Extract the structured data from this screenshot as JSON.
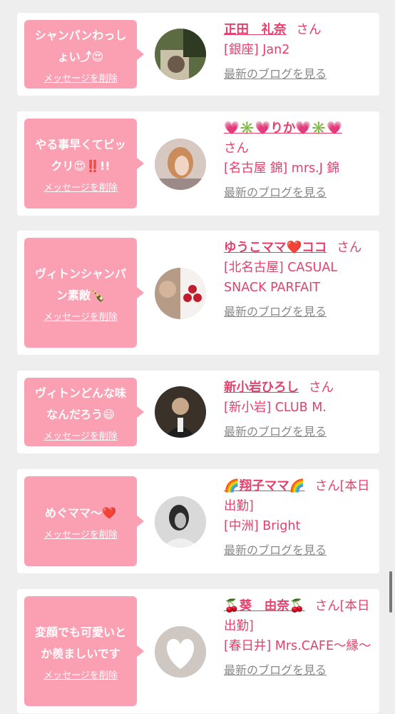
{
  "entries": [
    {
      "message_lines": [
        "シャンパンわっし",
        "ょい⤴😍"
      ],
      "delete_label": "メッセージを削除",
      "name": "正田　礼奈",
      "honorific": "さん",
      "shop": "[銀座] Jan2",
      "blog_label": "最新のブログを見る",
      "avatar": "photo-forest-window"
    },
    {
      "message_lines": [
        "やる事早くてビッ",
        "クリ😍‼️!!"
      ],
      "delete_label": "メッセージを削除",
      "name": "💗✳️💗りか💗✳️💗",
      "honorific": "さん",
      "shop": "[名古屋 錦] mrs.J 錦",
      "blog_label": "最新のブログを見る",
      "avatar": "photo-woman-blonde"
    },
    {
      "message_lines": [
        "ヴィトンシャンパ",
        "ン素敵🍾"
      ],
      "delete_label": "メッセージを削除",
      "name": "ゆうこママ❤️ココ",
      "honorific": "さん",
      "shop": "[北名古屋] CASUAL SNACK PARFAIT",
      "blog_label": "最新のブログを見る",
      "avatar": "photo-collage-cherries"
    },
    {
      "message_lines": [
        "ヴィトンどんな味",
        "なんだろう😄"
      ],
      "delete_label": "メッセージを削除",
      "name": "新小岩ひろし",
      "honorific": "さん",
      "shop": "[新小岩] CLUB M.",
      "blog_label": "最新のブログを見る",
      "avatar": "photo-man-suit"
    },
    {
      "message_lines": [
        "めぐママ〜❤️"
      ],
      "delete_label": "メッセージを削除",
      "name": "🌈翔子ママ🌈",
      "honorific": "さん[本日出勤]",
      "shop": "[中洲] Bright",
      "blog_label": "最新のブログを見る",
      "avatar": "photo-woman-bw"
    },
    {
      "message_lines": [
        "変顔でも可愛いと",
        "か羨ましいです"
      ],
      "delete_label": "メッセージを削除",
      "name": "🍒葵　由奈🍒",
      "honorific": "さん[本日出勤]",
      "shop": "[春日井] Mrs.CAFE〜縁〜",
      "blog_label": "最新のブログを見る",
      "avatar": "photo-heart-blur"
    }
  ],
  "colors": {
    "accent": "#e53f6c",
    "bubble": "#fb9fb3",
    "link_gray": "#888888"
  }
}
